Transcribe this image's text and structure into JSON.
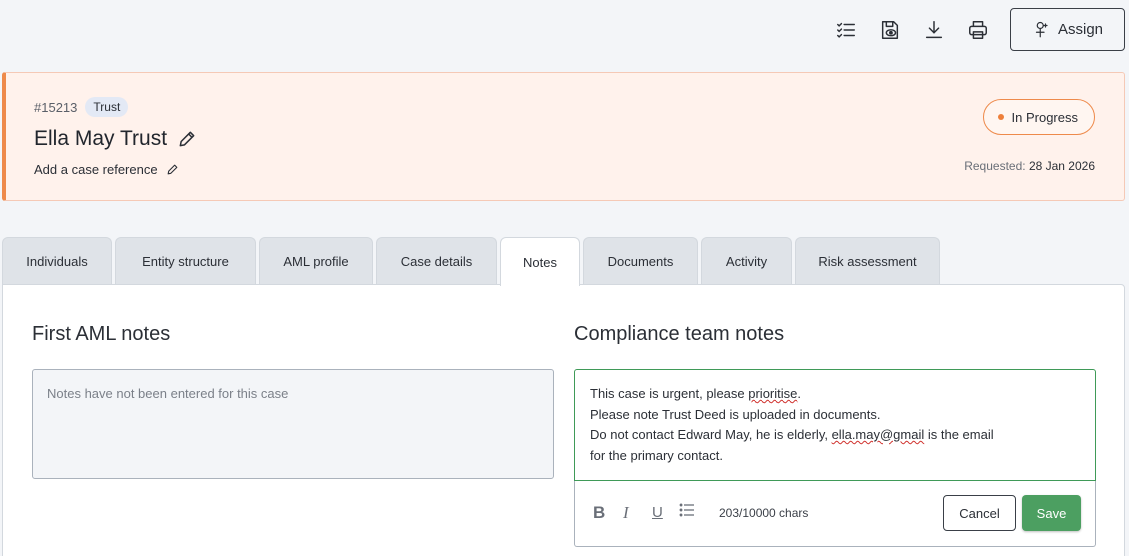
{
  "toolbar": {
    "icons": [
      "checklist-icon",
      "preview-icon",
      "download-icon",
      "print-icon"
    ],
    "assign_label": "Assign"
  },
  "case": {
    "id": "#15213",
    "type": "Trust",
    "title": "Ella May Trust",
    "reference_prompt": "Add a case reference",
    "status": "In Progress",
    "requested_label": "Requested:",
    "requested_date": "28 Jan 2026"
  },
  "tabs": [
    {
      "label": "Individuals"
    },
    {
      "label": "Entity structure"
    },
    {
      "label": "AML profile"
    },
    {
      "label": "Case details"
    },
    {
      "label": "Notes"
    },
    {
      "label": "Documents"
    },
    {
      "label": "Activity"
    },
    {
      "label": "Risk assessment"
    }
  ],
  "active_tab": "Notes",
  "notes": {
    "first_aml": {
      "title": "First AML notes",
      "placeholder": "Notes have not been entered for this case"
    },
    "compliance": {
      "title": "Compliance team notes",
      "lines": [
        {
          "pre": "This case is urgent, please ",
          "spell": "prioritise",
          "post": "."
        },
        {
          "pre": "Please note Trust Deed is uploaded in documents.",
          "spell": "",
          "post": ""
        },
        {
          "pre": "Do not contact Edward May, he is elderly, ",
          "spell": "ella.may@gmail",
          "post": " is the email"
        },
        {
          "pre": "for the primary contact.",
          "spell": "",
          "post": ""
        }
      ],
      "char_count": "203/10000 chars",
      "cancel_label": "Cancel",
      "save_label": "Save"
    }
  },
  "colors": {
    "accent_orange": "#ee8a4b",
    "save_green": "#4c9f61",
    "header_bg": "#fff2ec"
  }
}
